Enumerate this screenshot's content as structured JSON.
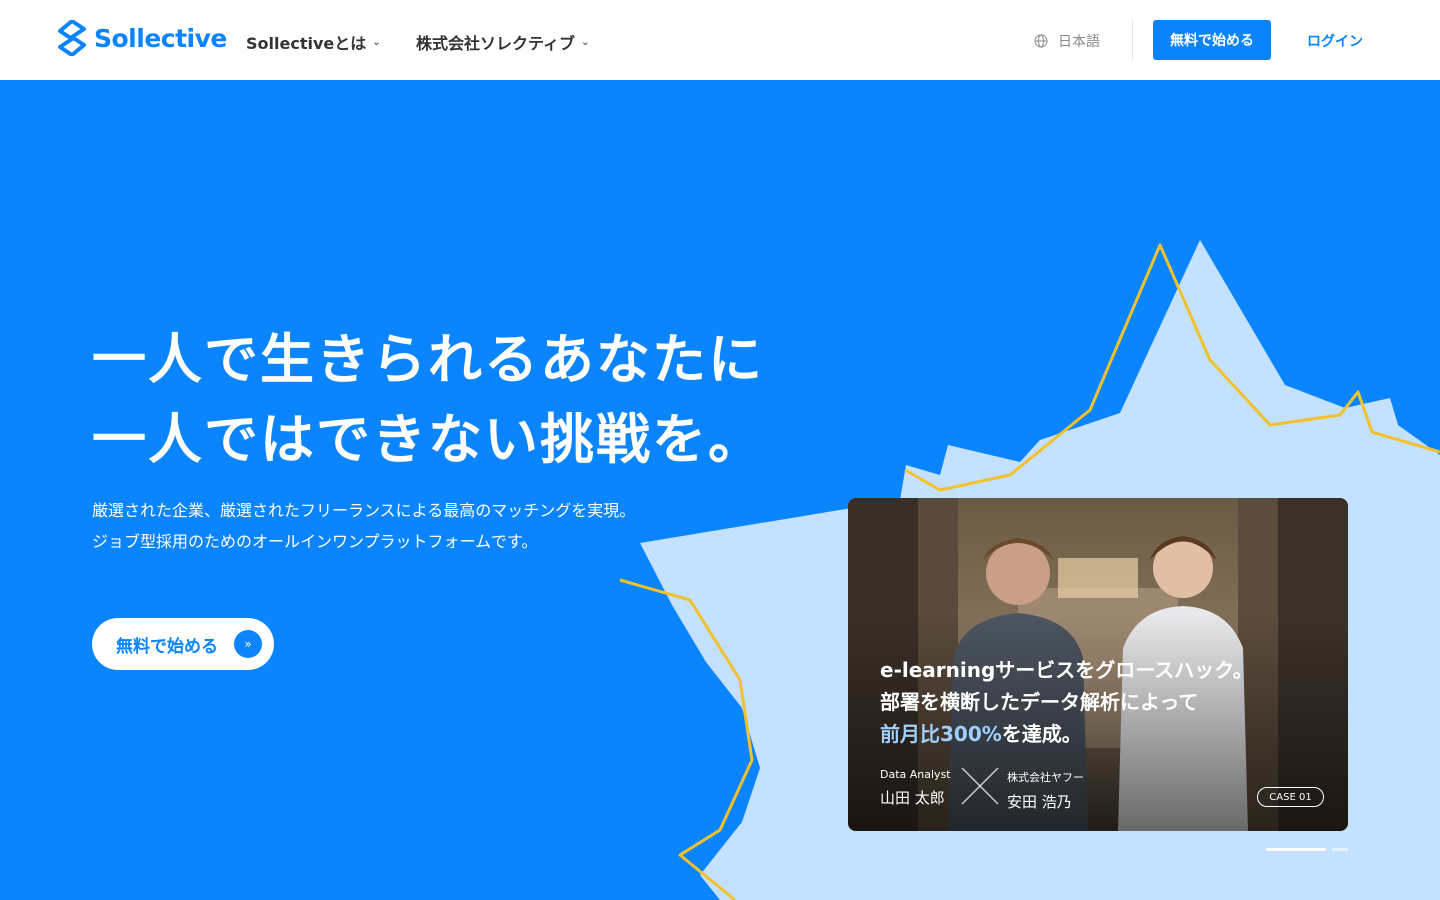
{
  "header": {
    "logo_text": "Sollective",
    "nav": [
      {
        "label": "Sollectiveとは"
      },
      {
        "label": "株式会社ソレクティブ"
      }
    ],
    "language": "日本語",
    "start_button": "無料で始める",
    "login": "ログイン"
  },
  "hero": {
    "headline_1": "一人で生きられるあなたに",
    "headline_2": "一人ではできない挑戦を。",
    "sub_1": "厳選された企業、厳選されたフリーランスによる最高のマッチングを実現。",
    "sub_2": "ジョブ型採用のためのオールインワンプラットフォームです。",
    "cta": "無料で始める"
  },
  "case_card": {
    "title_1": "e-learningサービスをグロースハック。",
    "title_2": "部署を横断したデータ解析によって",
    "title_3_highlight": "前月比300%",
    "title_3_rest": "を達成。",
    "person_1_role": "Data Analyst",
    "person_1_name": "山田 太郎",
    "person_2_role": "株式会社ヤフー",
    "person_2_name": "安田 浩乃",
    "badge": "CASE 01"
  },
  "carousel": {
    "slides": 2,
    "active": 0
  },
  "colors": {
    "primary": "#0a84ff",
    "splash": "#c4e2ff",
    "accent_line": "#f2c12e"
  }
}
